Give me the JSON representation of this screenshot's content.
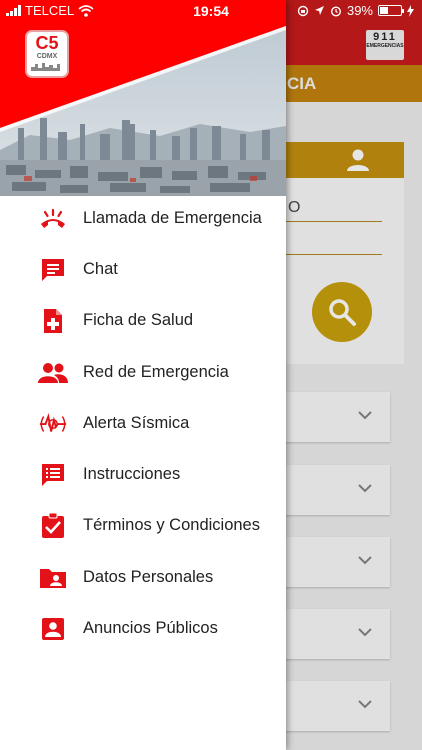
{
  "status_bar": {
    "carrier": "TELCEL",
    "time": "19:54",
    "battery_percent": "39%",
    "battery_level": 0.39
  },
  "background": {
    "logo_digits": "911",
    "logo_caption": "EMERGENCIAS",
    "band_text": "CIA",
    "field_text": "O"
  },
  "drawer": {
    "logo_text": "C5",
    "logo_subtext": "CDMX",
    "accent_color": "#ff0000",
    "items": [
      {
        "label": "Llamada de Emergencia",
        "icon": "phone-ringing-icon"
      },
      {
        "label": "Chat",
        "icon": "chat-icon"
      },
      {
        "label": "Ficha de Salud",
        "icon": "health-file-icon"
      },
      {
        "label": "Red de Emergencia",
        "icon": "people-icon"
      },
      {
        "label": "Alerta Sísmica",
        "icon": "seismic-alert-icon"
      },
      {
        "label": "Instrucciones",
        "icon": "instructions-icon"
      },
      {
        "label": "Términos y Condiciones",
        "icon": "clipboard-check-icon"
      },
      {
        "label": "Datos Personales",
        "icon": "folder-user-icon"
      },
      {
        "label": "Anuncios Públicos",
        "icon": "contact-box-icon"
      }
    ]
  }
}
